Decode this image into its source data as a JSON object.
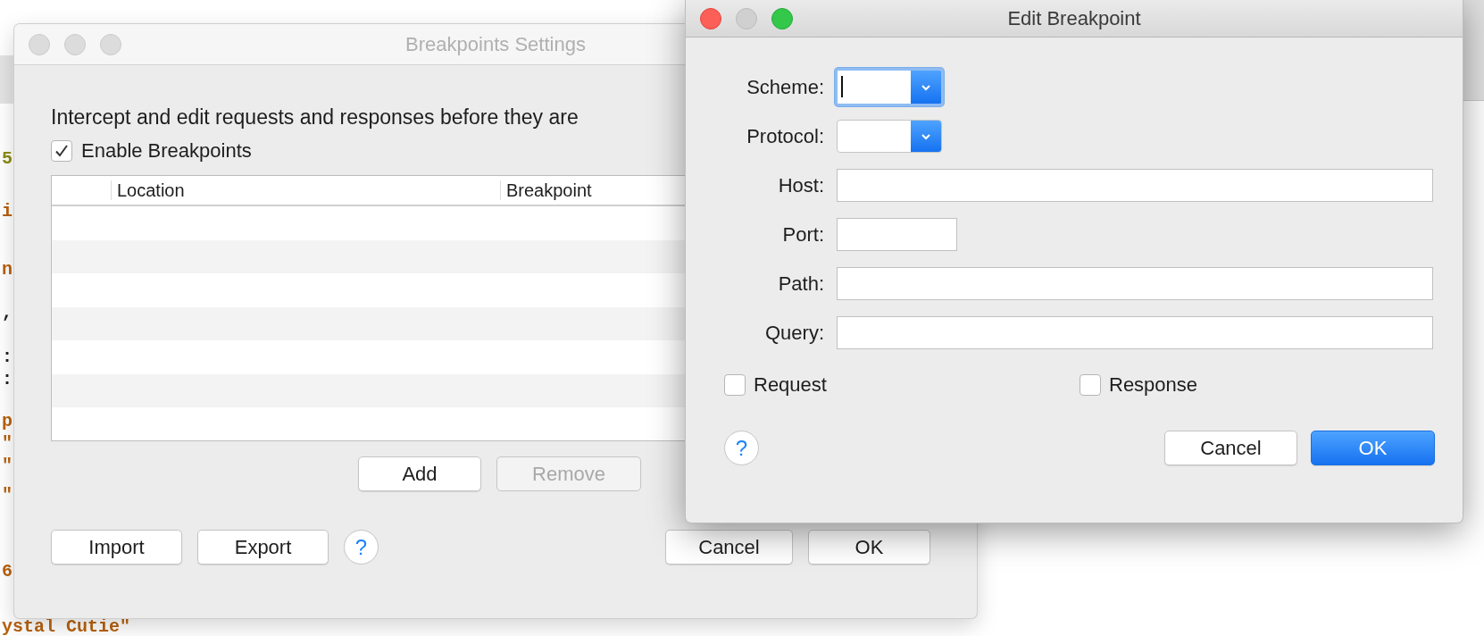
{
  "editor": {
    "lines": [
      {
        "text": "5",
        "color": "#8c8c17"
      },
      {
        "text": "i",
        "color": "#b8620f"
      },
      {
        "text": "n",
        "color": "#b8620f"
      },
      {
        "text": ",",
        "color": "#222222"
      },
      {
        "text": ":",
        "color": "#222222"
      },
      {
        "text": ":",
        "color": "#222222"
      },
      {
        "text": "p",
        "color": "#b8620f"
      },
      {
        "text": "\"",
        "color": "#b8620f"
      },
      {
        "text": "\"",
        "color": "#b8620f"
      },
      {
        "text": "\"",
        "color": "#b8620f"
      },
      {
        "text": "6",
        "color": "#b8620f"
      },
      {
        "text": "ystal Cutie\"",
        "color": "#b8620f"
      }
    ]
  },
  "settings_dialog": {
    "title": "Breakpoints Settings",
    "active": false,
    "description": "Intercept and edit requests and responses before they are",
    "enable": {
      "label": "Enable Breakpoints",
      "checked": true
    },
    "table": {
      "columns": [
        "Location",
        "Breakpoint"
      ]
    },
    "list_buttons": [
      {
        "label": "Add",
        "disabled": false
      },
      {
        "label": "Remove",
        "disabled": true
      }
    ],
    "footer_buttons": [
      {
        "label": "Import"
      },
      {
        "label": "Export"
      }
    ],
    "help": "?",
    "actions": [
      {
        "label": "Cancel"
      },
      {
        "label": "OK"
      }
    ]
  },
  "edit_dialog": {
    "title": "Edit Breakpoint",
    "active": true,
    "fields": [
      {
        "label": "Scheme:",
        "kind": "combo",
        "focused": true
      },
      {
        "label": "Protocol:",
        "kind": "combo",
        "focused": false
      },
      {
        "label": "Host:",
        "kind": "text"
      },
      {
        "label": "Port:",
        "kind": "short"
      },
      {
        "label": "Path:",
        "kind": "text"
      },
      {
        "label": "Query:",
        "kind": "text"
      }
    ],
    "checks": [
      {
        "label": "Request",
        "checked": false
      },
      {
        "label": "Response",
        "checked": false
      }
    ],
    "help": "?",
    "buttons": [
      {
        "label": "Cancel",
        "default": false
      },
      {
        "label": "OK",
        "default": true
      }
    ]
  }
}
